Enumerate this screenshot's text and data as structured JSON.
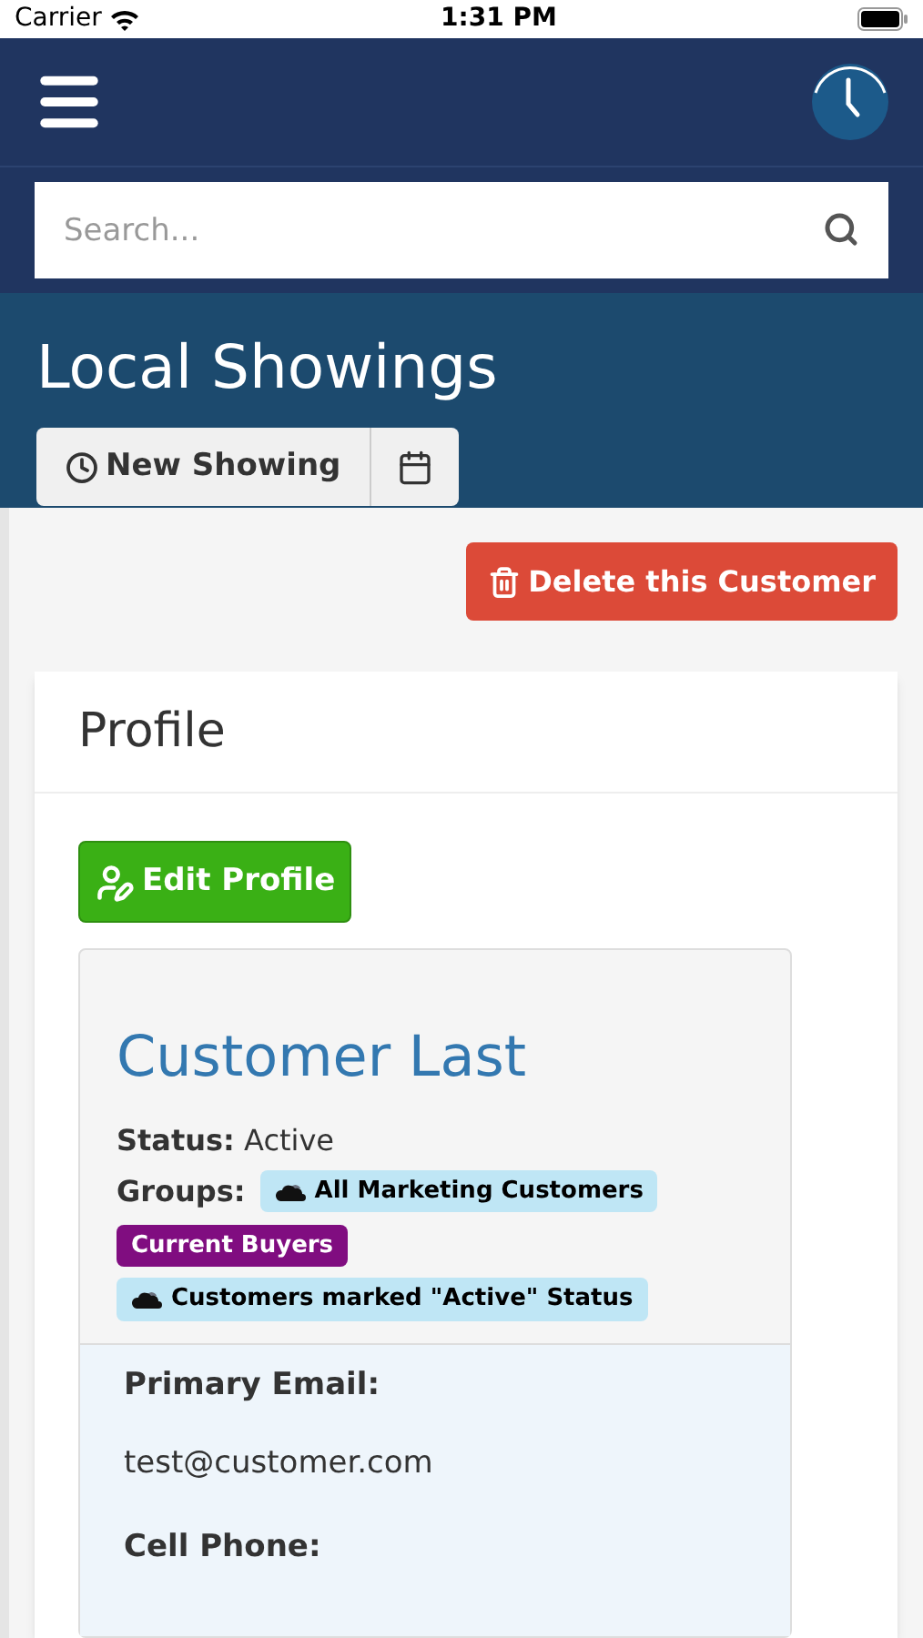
{
  "status_bar": {
    "carrier": "Carrier",
    "time": "1:31 PM"
  },
  "search": {
    "placeholder": "Search..."
  },
  "page": {
    "title": "Local Showings",
    "new_showing": "New Showing"
  },
  "delete_button": "Delete this Customer",
  "profile": {
    "title": "Profile",
    "edit_button": "Edit Profile",
    "name": "Customer Last",
    "status_label": "Status:",
    "status_value": "Active",
    "groups_label": "Groups:",
    "groups": [
      {
        "label": "All Marketing Customers",
        "kind": "smart",
        "color": "#bfe6f5"
      },
      {
        "label": "Current Buyers",
        "kind": "static",
        "color": "#800d80"
      },
      {
        "label": "Customers marked \"Active\" Status",
        "kind": "smart",
        "color": "#bfe6f5"
      }
    ],
    "fields": [
      {
        "label": "Primary Email:",
        "value": "test@customer.com"
      },
      {
        "label": "Cell Phone:"
      }
    ]
  }
}
